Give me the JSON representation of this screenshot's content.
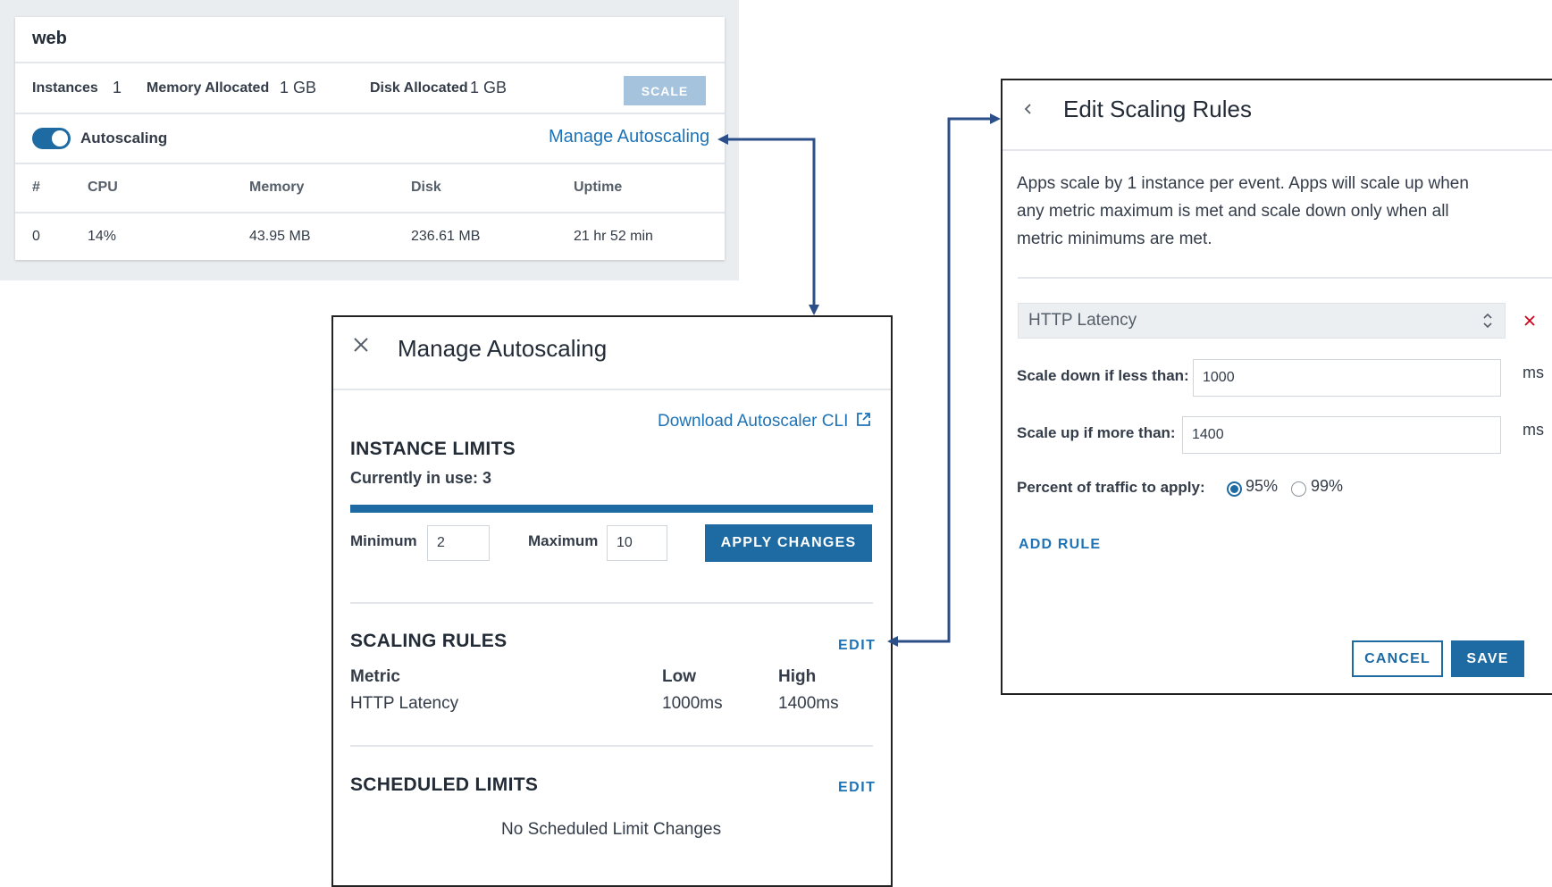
{
  "app_card": {
    "title": "web",
    "stats": {
      "instances_label": "Instances",
      "instances_value": "1",
      "memory_label": "Memory Allocated",
      "memory_value": "1 GB",
      "disk_label": "Disk Allocated",
      "disk_value": "1 GB"
    },
    "scale_button": "SCALE",
    "autoscaling_label": "Autoscaling",
    "autoscaling_enabled": true,
    "manage_link": "Manage Autoscaling",
    "table": {
      "headers": [
        "#",
        "CPU",
        "Memory",
        "Disk",
        "Uptime"
      ],
      "rows": [
        [
          "0",
          "14%",
          "43.95 MB",
          "236.61 MB",
          "21 hr 52 min"
        ]
      ]
    }
  },
  "manage_panel": {
    "title": "Manage Autoscaling",
    "download_link": "Download Autoscaler CLI",
    "instance_limits": {
      "heading": "INSTANCE LIMITS",
      "in_use": "Currently in use: 3",
      "minimum_label": "Minimum",
      "minimum_value": "2",
      "maximum_label": "Maximum",
      "maximum_value": "10",
      "apply_button": "APPLY CHANGES"
    },
    "scaling_rules": {
      "heading": "SCALING RULES",
      "edit": "EDIT",
      "col_metric": "Metric",
      "col_low": "Low",
      "col_high": "High",
      "row": {
        "metric": "HTTP Latency",
        "low": "1000ms",
        "high": "1400ms"
      }
    },
    "scheduled_limits": {
      "heading": "SCHEDULED LIMITS",
      "edit": "EDIT",
      "empty": "No Scheduled Limit Changes"
    }
  },
  "edit_panel": {
    "title": "Edit Scaling Rules",
    "description": "Apps scale by 1 instance per event. Apps will scale up when any metric maximum is met and scale down only when all metric minimums are met.",
    "metric_select": "HTTP Latency",
    "scale_down_label": "Scale down if less than:",
    "scale_down_value": "1000",
    "scale_up_label": "Scale up if more than:",
    "scale_up_value": "1400",
    "unit": "ms",
    "percent_label": "Percent of traffic to apply:",
    "percent_options": [
      "95%",
      "99%"
    ],
    "percent_selected": "95%",
    "add_rule": "ADD RULE",
    "cancel_button": "CANCEL",
    "save_button": "SAVE"
  },
  "colors": {
    "accent": "#1e6aa3",
    "link": "#1e73b6",
    "connector": "#2c4f8a",
    "remove": "#d0021b",
    "scale_disabled": "#a5c3dc"
  }
}
